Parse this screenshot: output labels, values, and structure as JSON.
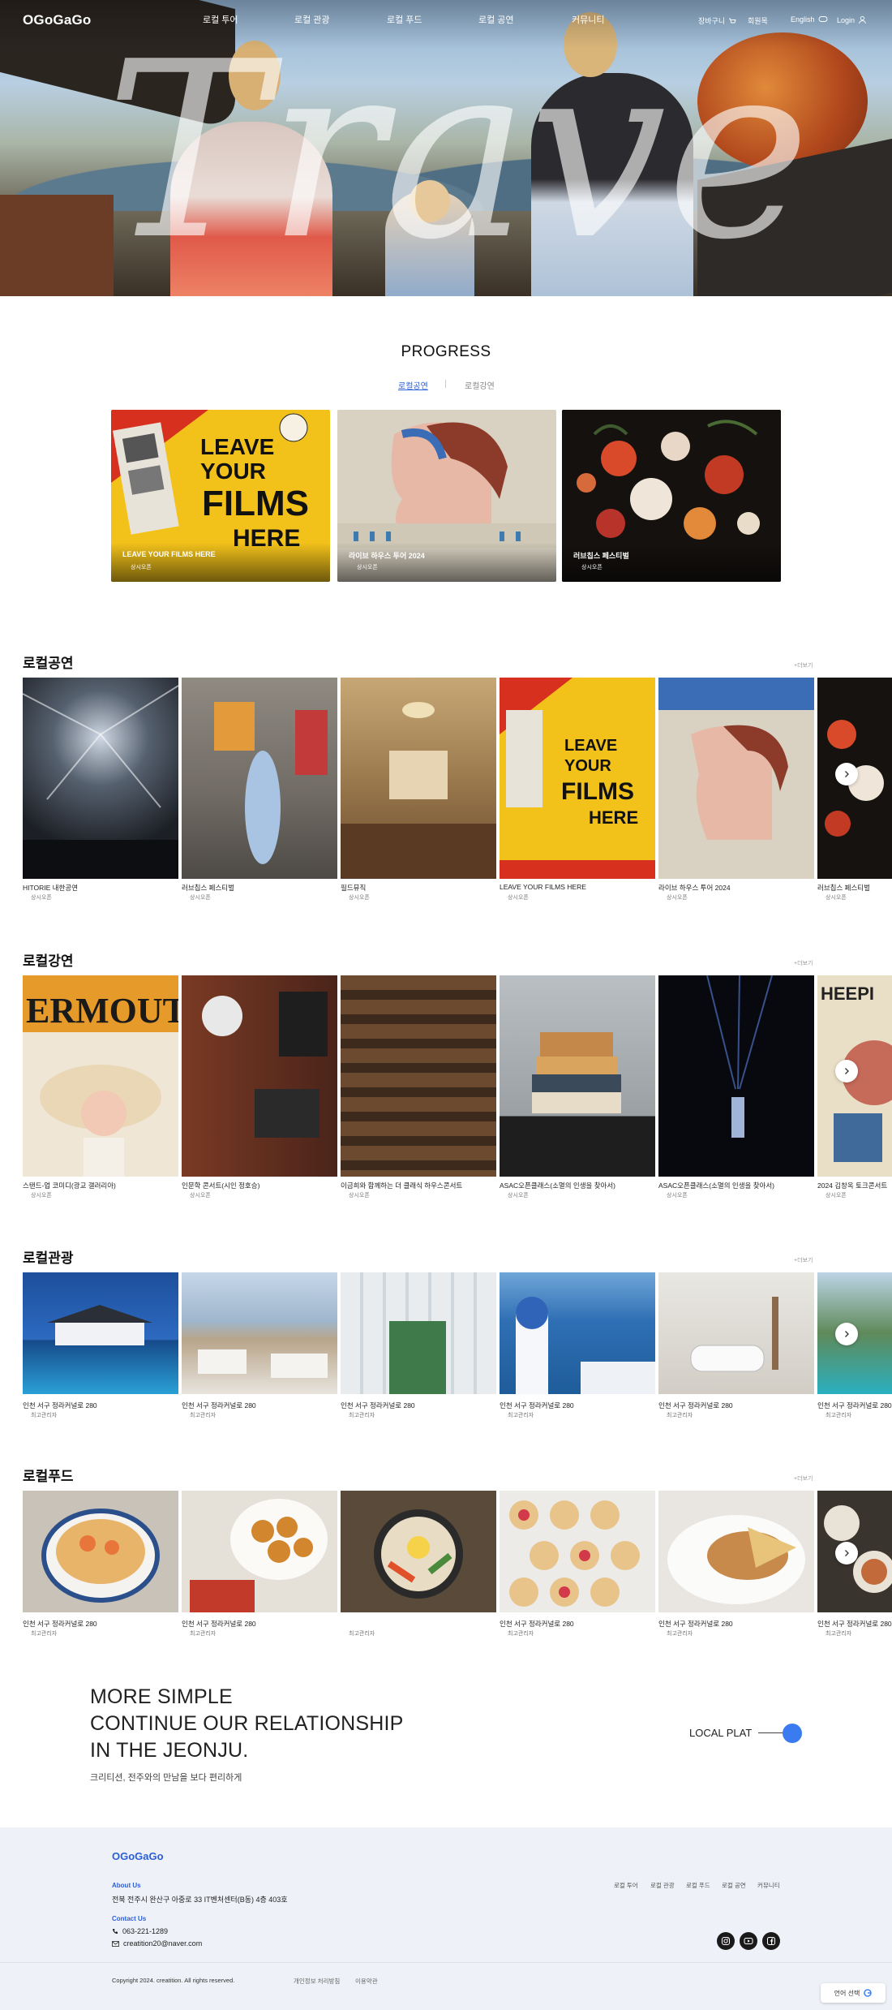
{
  "nav": {
    "logo": "OGoGaGo",
    "menu": [
      "로컬 투어",
      "로컬 관광",
      "로컬 푸드",
      "로컬 공연",
      "커뮤니티"
    ],
    "util": {
      "cart": "장바구니",
      "members": "회원목",
      "language": "English",
      "login": "Login"
    }
  },
  "hero": {
    "script_text": "Travel"
  },
  "progress": {
    "title": "PROGRESS",
    "tabs": [
      "로컬공연",
      "로컬강연"
    ],
    "cards": [
      {
        "title": "LEAVE YOUR FILMS HERE",
        "status": "상시오픈"
      },
      {
        "title": "라이브 하우스 투어 2024",
        "status": "상시오픈"
      },
      {
        "title": "러브칩스 페스티벌",
        "status": "상시오픈"
      }
    ]
  },
  "sections": [
    {
      "title": "로컬공연",
      "more": "+더보기",
      "items": [
        {
          "title": "HITORIE 내한공연",
          "sub": "상시오픈"
        },
        {
          "title": "러브칩스 페스티벌",
          "sub": "상시오픈"
        },
        {
          "title": "필드뮤직",
          "sub": "상시오픈"
        },
        {
          "title": "LEAVE YOUR FILMS HERE",
          "sub": "상시오픈"
        },
        {
          "title": "라이브 하우스 투어 2024",
          "sub": "상시오픈"
        },
        {
          "title": "러브칩스 페스티벌",
          "sub": "상시오픈"
        }
      ]
    },
    {
      "title": "로컬강연",
      "more": "+더보기",
      "items": [
        {
          "title": "스탠드-업 코미디(광교 갤러리아)",
          "sub": "상시오픈"
        },
        {
          "title": "인문학 콘서트(시인 정호승)",
          "sub": "상시오픈"
        },
        {
          "title": "이금희와 함께하는 더 클래식 하우스콘서트",
          "sub": "상시오픈"
        },
        {
          "title": "ASAC오픈클래스(소멸의 인생을 찾아서)",
          "sub": "상시오픈"
        },
        {
          "title": "ASAC오픈클래스(소멸의 인생을 찾아서)",
          "sub": "상시오픈"
        },
        {
          "title": "2024 김창옥 토크콘서트",
          "sub": "상시오픈"
        }
      ]
    },
    {
      "title": "로컬관광",
      "more": "+더보기",
      "items": [
        {
          "title": "인천 서구 정라커널로 280",
          "sub": "최고관리자"
        },
        {
          "title": "인천 서구 정라커널로 280",
          "sub": "최고관리자"
        },
        {
          "title": "인천 서구 정라커널로 280",
          "sub": "최고관리자"
        },
        {
          "title": "인천 서구 정라커널로 280",
          "sub": "최고관리자"
        },
        {
          "title": "인천 서구 정라커널로 280",
          "sub": "최고관리자"
        },
        {
          "title": "인천 서구 정라커널로 280",
          "sub": "최고관리자"
        }
      ]
    },
    {
      "title": "로컬푸드",
      "more": "+더보기",
      "items": [
        {
          "title": "인천 서구 정라커널로 280",
          "sub": "최고관리자"
        },
        {
          "title": "인천 서구 정라커널로 280",
          "sub": "최고관리자"
        },
        {
          "title": "",
          "sub": "최고관리자"
        },
        {
          "title": "인천 서구 정라커널로 280",
          "sub": "최고관리자"
        },
        {
          "title": "인천 서구 정라커널로 280",
          "sub": "최고관리자"
        },
        {
          "title": "인천 서구 정라커널로 280",
          "sub": "최고관리자"
        }
      ]
    }
  ],
  "promo": {
    "line1": "MORE SIMPLE",
    "line2": "CONTINUE OUR RELATIONSHIP",
    "line3": "IN THE JEONJU.",
    "sub": "크리티션, 전주와의 만남을 보다 편리하게",
    "cta": "LOCAL PLAT"
  },
  "footer": {
    "logo": "OGoGaGo",
    "about_label": "About Us",
    "address": "전북 전주시 완산구 아중로 33 IT벤처센터(B동) 4층 403호",
    "contact_label": "Contact Us",
    "phone": "063-221-1289",
    "email": "creatition20@naver.com",
    "links": [
      "로컬 투어",
      "로컬 관광",
      "로컬 푸드",
      "로컬 공연",
      "커뮤니티"
    ],
    "copyright": "Copyright 2024. creatition. All rights reserved.",
    "privacy": "개인정보 처리방침",
    "terms": "이용약관",
    "language_select": "언어 선택"
  },
  "colors": {
    "accent": "#2b5fd9",
    "cta_dot": "#3a7bf0",
    "footer_bg": "#eef1f7"
  }
}
